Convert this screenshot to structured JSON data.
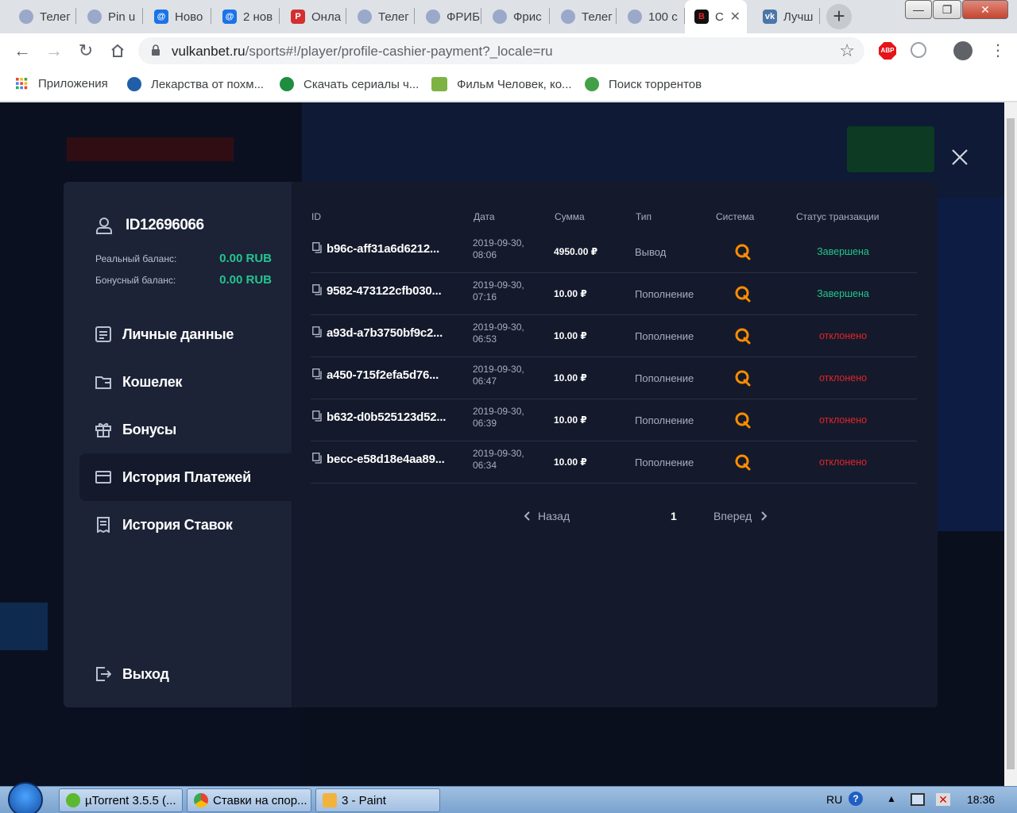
{
  "browser": {
    "tabs": [
      {
        "label": "Телег",
        "icon": "telegram-bot-icon"
      },
      {
        "label": "Pin u",
        "icon": "telegram-bot-icon"
      },
      {
        "label": "Ново",
        "icon": "mail-at-icon"
      },
      {
        "label": "2 нов",
        "icon": "mail-at-icon"
      },
      {
        "label": "Онла",
        "icon": "p-logo-icon"
      },
      {
        "label": "Телег",
        "icon": "telegram-bot-icon"
      },
      {
        "label": "ФРИБ",
        "icon": "telegram-bot-icon"
      },
      {
        "label": "Фрис",
        "icon": "telegram-bot-icon"
      },
      {
        "label": "Телег",
        "icon": "telegram-bot-icon"
      },
      {
        "label": "100 с",
        "icon": "telegram-bot-icon"
      },
      {
        "label": "С",
        "icon": "vulkan-b-icon",
        "active": true
      },
      {
        "label": "Лучш",
        "icon": "vk-icon"
      }
    ],
    "url_host": "vulkanbet.ru",
    "url_path": "/sports#!/player/profile-cashier-payment?_locale=ru",
    "abp_label": "ABP",
    "bookmarks": [
      {
        "label": "Приложения",
        "icon": "apps-grid-icon"
      },
      {
        "label": "Лекарства от похм...",
        "icon": "pill-site-icon"
      },
      {
        "label": "Скачать сериалы ч...",
        "icon": "torrent-icon"
      },
      {
        "label": "Фильм Человек, ко...",
        "icon": "hd-icon"
      },
      {
        "label": "Поиск торрентов",
        "icon": "n-logo-icon"
      }
    ]
  },
  "profile": {
    "user_id": "ID12696066",
    "real_balance_label": "Реальный баланс:",
    "real_balance_value": "0.00 RUB",
    "bonus_balance_label": "Бонусный баланс:",
    "bonus_balance_value": "0.00 RUB",
    "menu": [
      {
        "label": "Личные данные",
        "icon": "document-icon"
      },
      {
        "label": "Кошелек",
        "icon": "wallet-icon"
      },
      {
        "label": "Бонусы",
        "icon": "gift-icon"
      },
      {
        "label": "История Платежей",
        "icon": "card-icon",
        "active": true
      },
      {
        "label": "История Ставок",
        "icon": "receipt-icon"
      }
    ],
    "logout_label": "Выход"
  },
  "payments": {
    "columns": [
      "ID",
      "Дата",
      "Сумма",
      "Тип",
      "Система",
      "Статус транзакции"
    ],
    "rows": [
      {
        "id": "b96c-aff31a6d6212...",
        "date1": "2019-09-30,",
        "date2": "08:06",
        "sum": "4950.00 ₽",
        "type": "Вывод",
        "system": "qiwi-icon",
        "status": "Завершена",
        "status_kind": "ok"
      },
      {
        "id": "9582-473122cfb030...",
        "date1": "2019-09-30,",
        "date2": "07:16",
        "sum": "10.00 ₽",
        "type": "Пополнение",
        "system": "qiwi-icon",
        "status": "Завершена",
        "status_kind": "ok"
      },
      {
        "id": "a93d-a7b3750bf9c2...",
        "date1": "2019-09-30,",
        "date2": "06:53",
        "sum": "10.00 ₽",
        "type": "Пополнение",
        "system": "qiwi-icon",
        "status": "отклонено",
        "status_kind": "bad"
      },
      {
        "id": "a450-715f2efa5d76...",
        "date1": "2019-09-30,",
        "date2": "06:47",
        "sum": "10.00 ₽",
        "type": "Пополнение",
        "system": "qiwi-icon",
        "status": "отклонено",
        "status_kind": "bad"
      },
      {
        "id": "b632-d0b525123d52...",
        "date1": "2019-09-30,",
        "date2": "06:39",
        "sum": "10.00 ₽",
        "type": "Пополнение",
        "system": "qiwi-icon",
        "status": "отклонено",
        "status_kind": "bad"
      },
      {
        "id": "becc-e58d18e4aa89...",
        "date1": "2019-09-30,",
        "date2": "06:34",
        "sum": "10.00 ₽",
        "type": "Пополнение",
        "system": "qiwi-icon",
        "status": "отклонено",
        "status_kind": "bad"
      }
    ],
    "pager": {
      "prev": "Назад",
      "page": "1",
      "next": "Вперед"
    }
  },
  "taskbar": {
    "tasks": [
      {
        "label": "µTorrent 3.5.5  (...",
        "icon": "utorrent-icon"
      },
      {
        "label": "Ставки на спор...",
        "icon": "chrome-icon"
      },
      {
        "label": "3 - Paint",
        "icon": "paint-icon"
      }
    ],
    "lang": "RU",
    "clock": "18:36"
  },
  "colors": {
    "accent_green": "#23c58f",
    "status_declined": "#e3242b",
    "modal_bg": "#1c2336",
    "table_bg": "#141a2b",
    "qiwi_orange": "#ff8c00"
  }
}
